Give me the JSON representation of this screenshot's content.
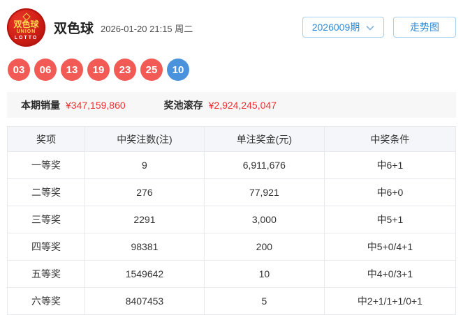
{
  "header": {
    "logo_line1": "双色球",
    "logo_line2": "UNION",
    "logo_line3": "LOTTO",
    "title": "双色球",
    "datetime": "2026-01-20 21:15 周二",
    "period_label": "2026009期",
    "trend_button_label": "走势图"
  },
  "balls": {
    "items": [
      {
        "value": "03",
        "color": "red"
      },
      {
        "value": "06",
        "color": "red"
      },
      {
        "value": "13",
        "color": "red"
      },
      {
        "value": "19",
        "color": "red"
      },
      {
        "value": "23",
        "color": "red"
      },
      {
        "value": "25",
        "color": "red"
      },
      {
        "value": "10",
        "color": "blue"
      }
    ]
  },
  "summary": {
    "sales_label": "本期销量",
    "sales_value": "¥347,159,860",
    "pool_label": "奖池滚存",
    "pool_value": "¥2,924,245,047"
  },
  "table": {
    "headers": [
      "奖项",
      "中奖注数(注)",
      "单注奖金(元)",
      "中奖条件"
    ],
    "rows": [
      {
        "prize": "一等奖",
        "count": "9",
        "amount": "6,911,676",
        "condition": "中6+1"
      },
      {
        "prize": "二等奖",
        "count": "276",
        "amount": "77,921",
        "condition": "中6+0"
      },
      {
        "prize": "三等奖",
        "count": "2291",
        "amount": "3,000",
        "condition": "中5+1"
      },
      {
        "prize": "四等奖",
        "count": "98381",
        "amount": "200",
        "condition": "中5+0/4+1"
      },
      {
        "prize": "五等奖",
        "count": "1549642",
        "amount": "10",
        "condition": "中4+0/3+1"
      },
      {
        "prize": "六等奖",
        "count": "8407453",
        "amount": "5",
        "condition": "中2+1/1+1/0+1"
      }
    ]
  },
  "colors": {
    "red_ball": "#f25b55",
    "blue_ball": "#4a93dc",
    "accent_blue": "#2e8bd8",
    "value_red": "#ee2f2f"
  }
}
